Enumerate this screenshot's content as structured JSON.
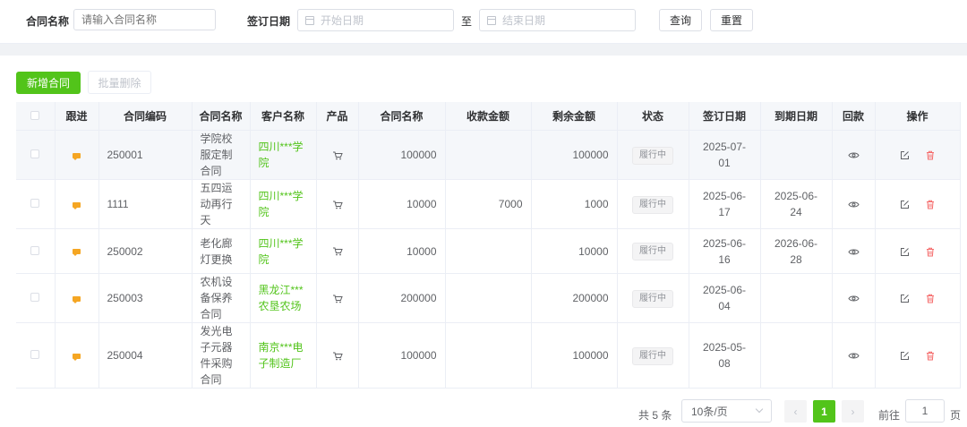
{
  "filters": {
    "contract_name_label": "合同名称",
    "contract_name_placeholder": "请输入合同名称",
    "sign_date_label": "签订日期",
    "start_date_placeholder": "开始日期",
    "to_label": "至",
    "end_date_placeholder": "结束日期",
    "query_label": "查询",
    "reset_label": "重置"
  },
  "toolbar": {
    "add_label": "新增合同",
    "batch_delete_label": "批量删除"
  },
  "table": {
    "headers": [
      "跟进",
      "合同编码",
      "合同名称",
      "客户名称",
      "产品",
      "合同名称",
      "收款金额",
      "剩余金额",
      "状态",
      "签订日期",
      "到期日期",
      "回款",
      "操作"
    ],
    "rows": [
      {
        "code": "250001",
        "name": "学院校服定制合同",
        "customer": "四川***学院",
        "amount": "100000",
        "received": "",
        "remaining": "100000",
        "status": "履行中",
        "sign_date": "2025-07-01",
        "due_date": ""
      },
      {
        "code": "1111",
        "name": "五四运动再行天",
        "customer": "四川***学院",
        "amount": "10000",
        "received": "7000",
        "remaining": "1000",
        "status": "履行中",
        "sign_date": "2025-06-17",
        "due_date": "2025-06-24"
      },
      {
        "code": "250002",
        "name": "老化廊灯更换",
        "customer": "四川***学院",
        "amount": "10000",
        "received": "",
        "remaining": "10000",
        "status": "履行中",
        "sign_date": "2025-06-16",
        "due_date": "2026-06-28"
      },
      {
        "code": "250003",
        "name": "农机设备保养合同",
        "customer": "黑龙江***农垦农场",
        "amount": "200000",
        "received": "",
        "remaining": "200000",
        "status": "履行中",
        "sign_date": "2025-06-04",
        "due_date": ""
      },
      {
        "code": "250004",
        "name": "发光电子元器件采购合同",
        "customer": "南京***电子制造厂",
        "amount": "100000",
        "received": "",
        "remaining": "100000",
        "status": "履行中",
        "sign_date": "2025-05-08",
        "due_date": ""
      }
    ]
  },
  "pagination": {
    "total_text": "共 5 条",
    "page_size": "10条/页",
    "current_page": "1",
    "goto_label": "前往",
    "goto_value": "1",
    "page_suffix": "页"
  },
  "colors": {
    "primary": "#52c41a",
    "follow_icon": "#f5a623",
    "delete_icon": "#f56c6c"
  }
}
